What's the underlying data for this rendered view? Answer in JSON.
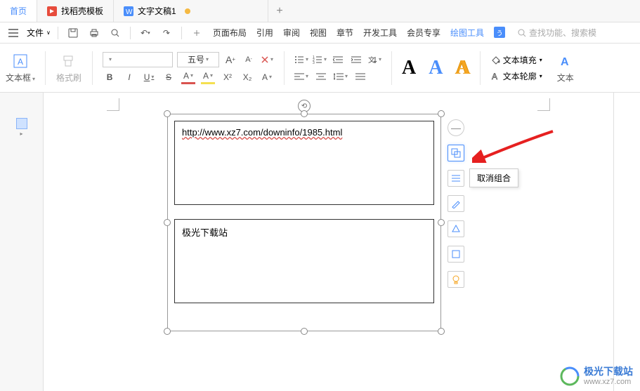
{
  "tabs": {
    "home": "首页",
    "template": "找稻壳模板",
    "doc": "文字文稿1"
  },
  "menubar": {
    "file": "文件",
    "layout": "页面布局",
    "reference": "引用",
    "review": "审阅",
    "view": "视图",
    "chapter": "章节",
    "devtools": "开发工具",
    "member": "会员专享",
    "drawing": "绘图工具",
    "search_placeholder": "查找功能、搜索模"
  },
  "ribbon": {
    "textbox": "文本框",
    "formatpainter": "格式刷",
    "font_size": "五号",
    "bold": "B",
    "italic": "I",
    "underline": "U",
    "strike": "S",
    "color_A": "A",
    "highlight_A": "A",
    "xsup": "X²",
    "xsub": "X₂",
    "caseA": "A",
    "textfill": "文本填充",
    "textoutline": "文本轮廓",
    "texteffect": "文本"
  },
  "canvas": {
    "box1_text": "http://www.xz7.com/downinfo/1985.html",
    "box2_text": "极光下载站"
  },
  "float": {
    "tooltip": "取消组合"
  },
  "watermark": {
    "title": "极光下载站",
    "url": "www.xz7.com"
  }
}
